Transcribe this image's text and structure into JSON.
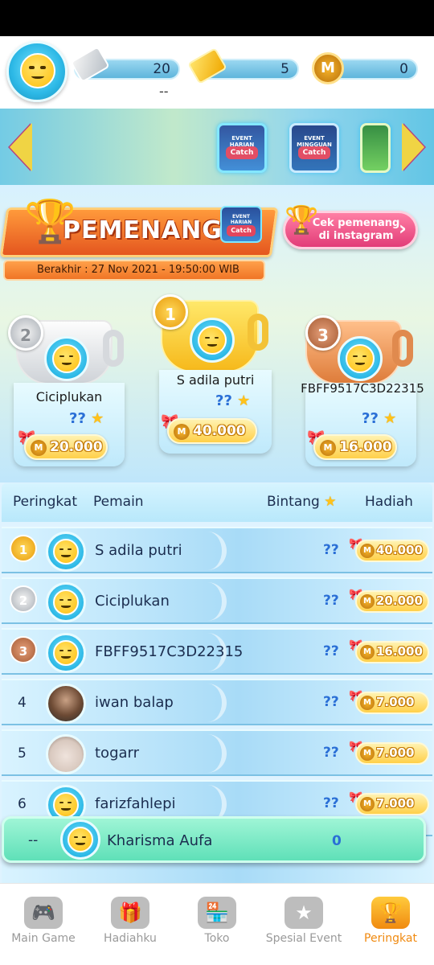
{
  "resources": {
    "ticket_silver": "20",
    "ticket_silver_sub": "--",
    "ticket_gold": "5",
    "coins": "0"
  },
  "events": [
    {
      "title": "EVENT HARIAN",
      "catch": "Catch"
    },
    {
      "title": "EVENT MINGGUAN",
      "catch": "Catch"
    }
  ],
  "winner": {
    "title": "PEMENANG",
    "badge_title": "EVENT HARIAN",
    "badge_catch": "Catch",
    "instagram_label": "Cek pemenang di instagram",
    "deadline": "Berakhir : 27 Nov 2021 - 19:50:00 WIB"
  },
  "podium": [
    {
      "rank": "2",
      "name": "Ciciplukan",
      "stars": "??",
      "prize": "20.000"
    },
    {
      "rank": "1",
      "name": "S adila putri",
      "stars": "??",
      "prize": "40.000"
    },
    {
      "rank": "3",
      "name": "FBFF9517C3D22315",
      "stars": "??",
      "prize": "16.000"
    }
  ],
  "table": {
    "headers": {
      "rank": "Peringkat",
      "player": "Pemain",
      "stars": "Bintang",
      "prize": "Hadiah"
    },
    "rows": [
      {
        "rank": "1",
        "name": "S adila putri",
        "stars": "??",
        "prize": "40.000"
      },
      {
        "rank": "2",
        "name": "Ciciplukan",
        "stars": "??",
        "prize": "20.000"
      },
      {
        "rank": "3",
        "name": "FBFF9517C3D22315",
        "stars": "??",
        "prize": "16.000"
      },
      {
        "rank": "4",
        "name": "iwan balap",
        "stars": "??",
        "prize": "7.000"
      },
      {
        "rank": "5",
        "name": "togarr",
        "stars": "??",
        "prize": "7.000"
      },
      {
        "rank": "6",
        "name": "farizfahlepi",
        "stars": "??",
        "prize": "7.000"
      }
    ]
  },
  "self": {
    "rank": "--",
    "name": "Kharisma Aufa",
    "stars": "0"
  },
  "nav": [
    {
      "label": "Main Game",
      "icon": "gamepad-icon"
    },
    {
      "label": "Hadiahku",
      "icon": "gift-icon"
    },
    {
      "label": "Toko",
      "icon": "shop-icon"
    },
    {
      "label": "Spesial Event",
      "icon": "event-icon"
    },
    {
      "label": "Peringkat",
      "icon": "trophy-icon"
    }
  ],
  "colors": {
    "accent_orange": "#f08a10",
    "pill_blue": "#5eb5dc",
    "self_row": "#5fe0b8"
  }
}
